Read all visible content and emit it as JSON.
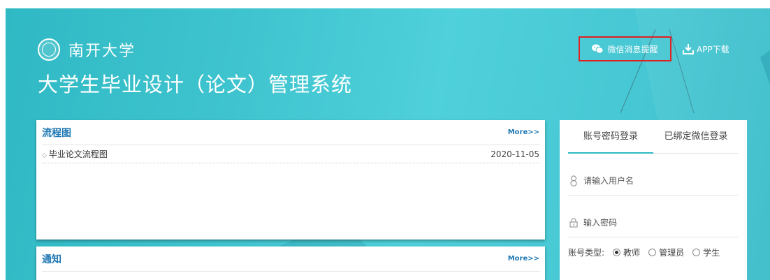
{
  "header": {
    "university": "南开大学",
    "system_title": "大学生毕业设计（论文）管理系统",
    "wechat_reminder": "微信消息提醒",
    "app_download": "APP下载"
  },
  "flowchart": {
    "title": "流程图",
    "more": "More>>",
    "items": [
      {
        "title": "毕业论文流程图",
        "date": "2020-11-05"
      }
    ]
  },
  "notice": {
    "title": "通知",
    "more": "More>>"
  },
  "login": {
    "tabs": [
      "账号密码登录",
      "已绑定微信登录"
    ],
    "active_tab": 0,
    "username_placeholder": "请输入用户名",
    "password_placeholder": "输入密码",
    "account_type_label": "账号类型:",
    "account_types": [
      "教师",
      "管理员",
      "学生"
    ],
    "selected_type": "教师"
  },
  "colors": {
    "background": "#3fc4cf",
    "link_blue": "#1f78b4",
    "highlight_red": "#e02020"
  }
}
